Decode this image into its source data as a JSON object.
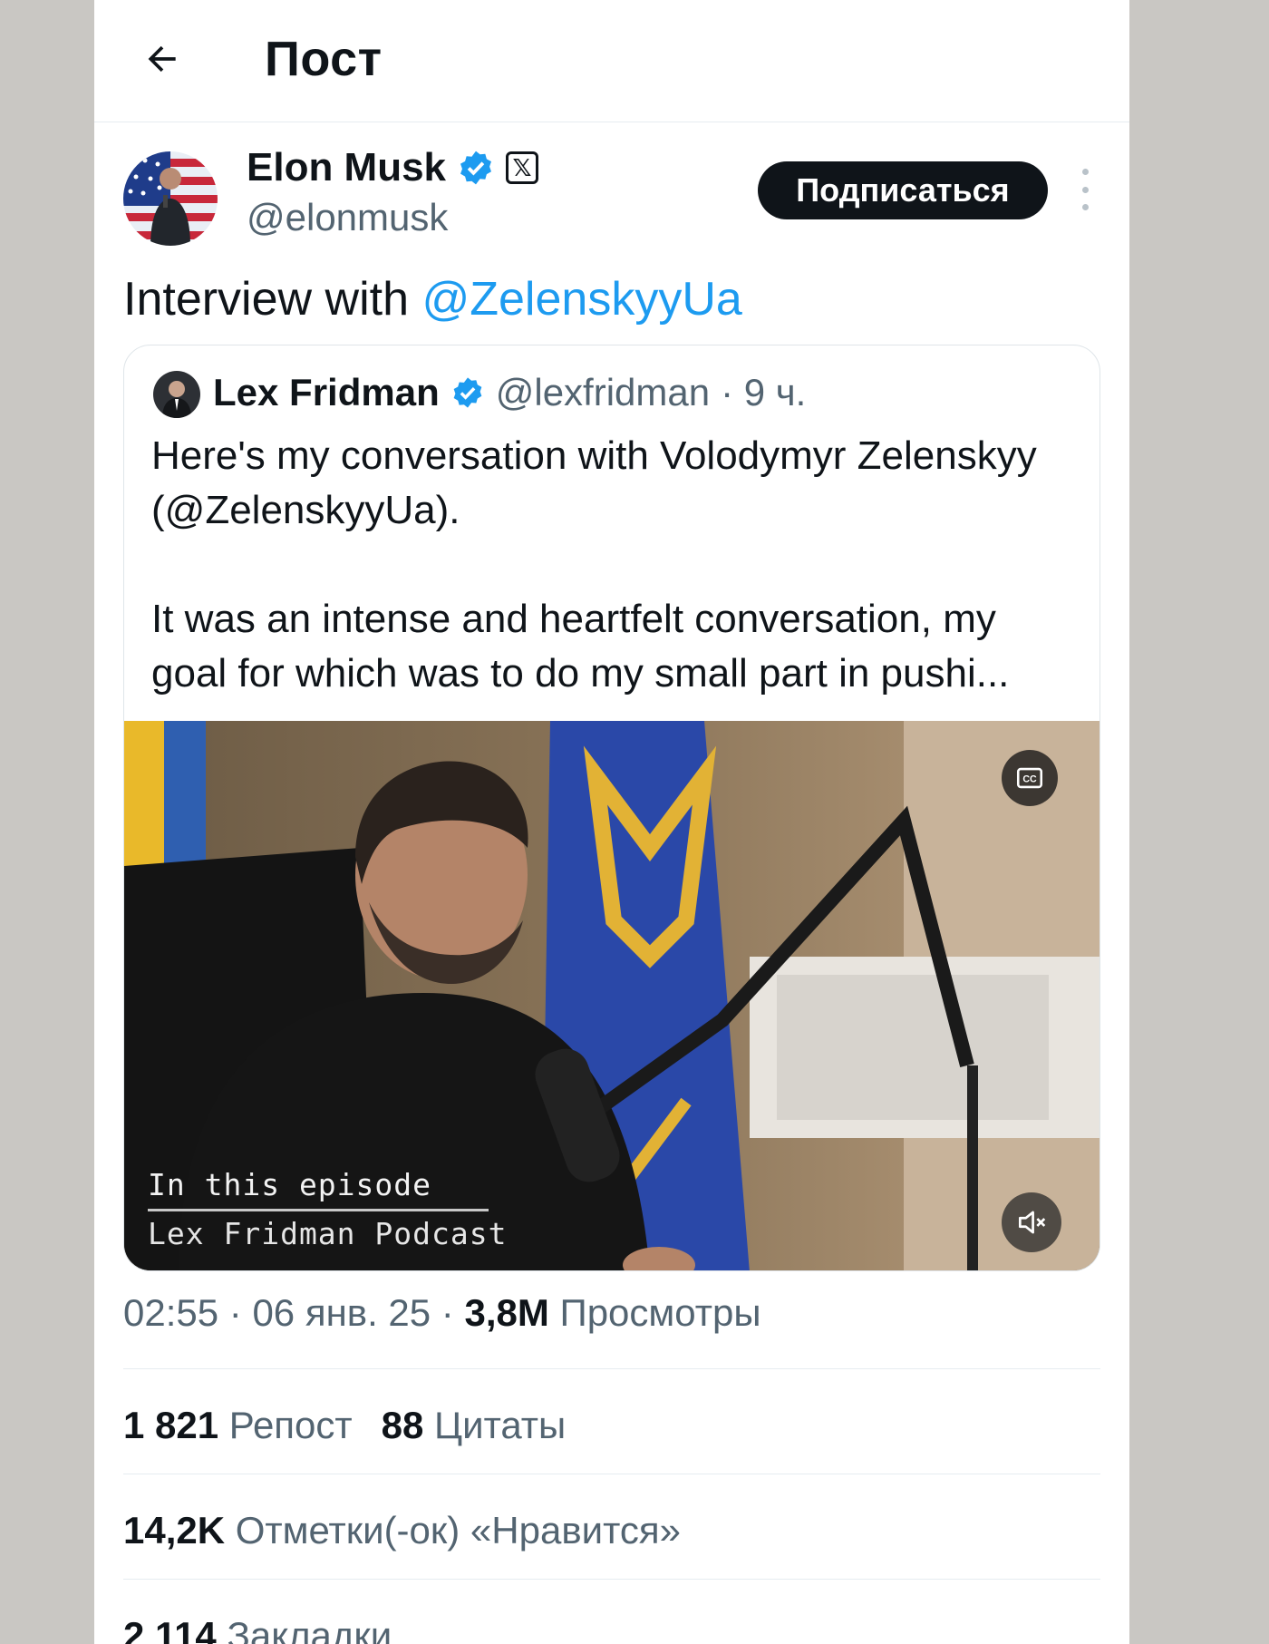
{
  "header": {
    "title": "Пост"
  },
  "author": {
    "name": "Elon Musk",
    "handle": "@elonmusk",
    "follow_label": "Подписаться"
  },
  "tweet": {
    "text_prefix": "Interview with ",
    "mention": "@ZelenskyyUa"
  },
  "quote": {
    "name": "Lex Fridman",
    "handle": "@lexfridman",
    "time": "· 9 ч.",
    "paragraph1": "Here's my conversation with Volodymyr Zelenskyy (@ZelenskyyUa).",
    "paragraph2": "It was an intense and heartfelt conversation, my goal for which was to do my small part in pushi...",
    "video_overlay_line1": "In this episode",
    "video_overlay_line2": "Lex Fridman Podcast"
  },
  "meta": {
    "time": "02:55",
    "date": "06 янв. 25",
    "views_count": "3,8M",
    "views_label": "Просмотры",
    "sep": " · "
  },
  "stats": {
    "reposts_count": "1 821",
    "reposts_label": "Репост",
    "quotes_count": "88",
    "quotes_label": "Цитаты",
    "likes_count": "14,2K",
    "likes_label": "Отметки(-ок) «Нравится»",
    "bookmarks_count": "2 114",
    "bookmarks_label": "Закладки"
  },
  "colors": {
    "link": "#1d9bf0",
    "text": "#0f1419",
    "muted": "#536471",
    "follow_bg": "#0f1419"
  },
  "icons": [
    "back-arrow-icon",
    "verified-badge-icon",
    "x-logo-icon",
    "more-options-icon",
    "closed-captions-icon",
    "mute-icon"
  ]
}
